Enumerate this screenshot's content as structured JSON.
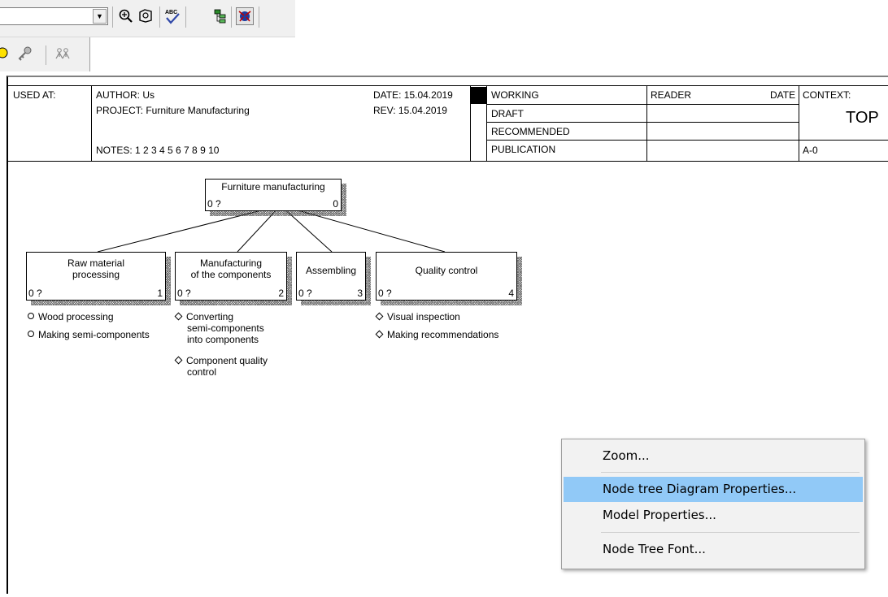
{
  "toolbar": {
    "combo_value": "",
    "icons": [
      "zoom-in-icon",
      "zoom-fit-icon",
      "spell-check-icon",
      "node-tree-icon",
      "model-explorer-icon",
      "bulb-icon",
      "key-icon",
      "people-icon"
    ]
  },
  "header": {
    "used_at": "USED AT:",
    "author": "AUTHOR:  Us",
    "project": "PROJECT:  Furniture Manufacturing",
    "notes": "NOTES:  1  2  3  4  5  6  7  8  9  10",
    "date": "DATE:  15.04.2019",
    "rev": "REV:   15.04.2019",
    "status": [
      "WORKING",
      "DRAFT",
      "RECOMMENDED",
      "PUBLICATION"
    ],
    "reader": "READER",
    "date_col": "DATE",
    "context": "CONTEXT:",
    "top": "TOP",
    "node_number": "A-0"
  },
  "tree": {
    "root": {
      "label": "Furniture manufacturing",
      "left": "0 ?",
      "num": "0"
    },
    "children": [
      {
        "label1": "Raw material",
        "label2": "processing",
        "left": "0 ?",
        "num": "1"
      },
      {
        "label1": "Manufacturing",
        "label2": "of the components",
        "left": "0 ?",
        "num": "2"
      },
      {
        "label1": "Assembling",
        "label2": "",
        "left": "0 ?",
        "num": "3"
      },
      {
        "label1": "Quality control",
        "label2": "",
        "left": "0 ?",
        "num": "4"
      }
    ],
    "notes": {
      "raw1": "Wood processing",
      "raw2": "Making semi-components",
      "man1a": "Converting",
      "man1b": "semi-components",
      "man1c": "into components",
      "man2a": "Component  quality",
      "man2b": "control",
      "qc1": "Visual inspection",
      "qc2": "Making recommendations"
    }
  },
  "context_menu": {
    "items": [
      "Zoom...",
      "Node tree Diagram Properties...",
      "Model Properties...",
      "Node Tree Font..."
    ],
    "highlighted": "Node tree Diagram Properties..."
  },
  "colors": {
    "menu_highlight": "#91c9f7",
    "menu_bg": "#f2f2f2"
  }
}
